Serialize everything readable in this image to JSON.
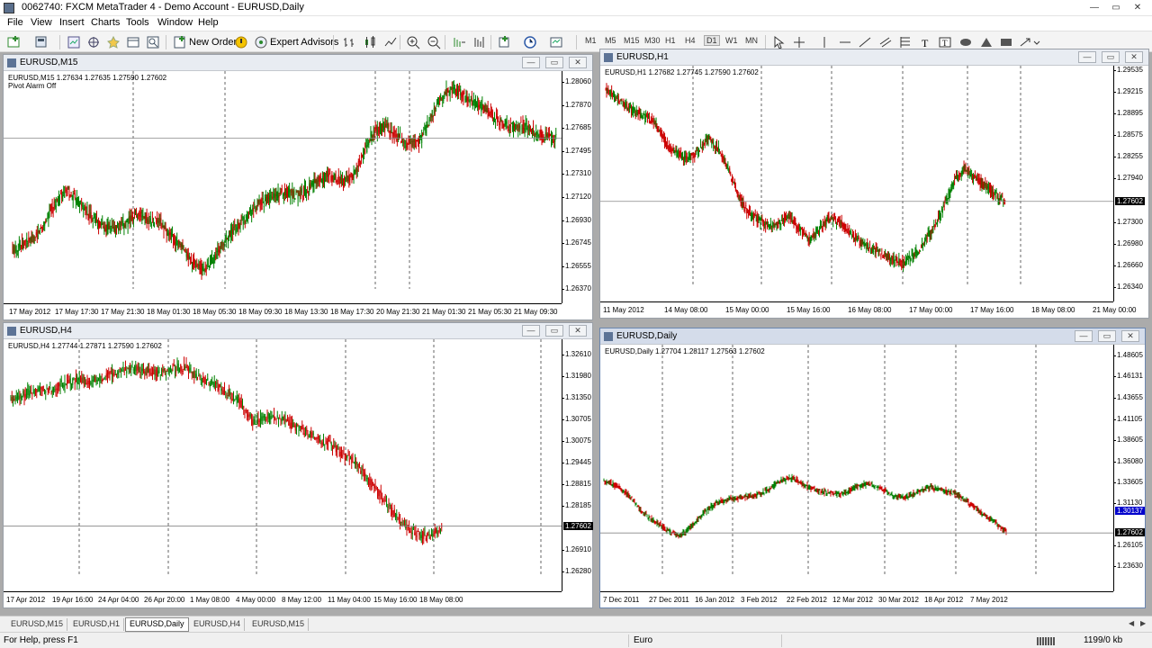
{
  "window": {
    "title": "0062740: FXCM MetaTrader 4 - Demo Account - EURUSD,Daily",
    "min": "—",
    "max": "▭",
    "close": "✕"
  },
  "menu": [
    "File",
    "View",
    "Insert",
    "Charts",
    "Tools",
    "Window",
    "Help"
  ],
  "toolbar": {
    "new_order": "New Order",
    "expert_advisors": "Expert Advisors",
    "timeframes": [
      "M1",
      "M5",
      "M15",
      "M30",
      "H1",
      "H4",
      "D1",
      "W1",
      "MN"
    ],
    "selected_timeframe": "D1"
  },
  "charts": [
    {
      "id": "m15",
      "title": "EURUSD,M15",
      "info": "EURUSD,M15  1.27634 1.27635 1.27590 1.27602",
      "info2": "Pivot Alarm Off",
      "prices": [
        "1.28060",
        "1.27870",
        "1.27685",
        "1.27495",
        "1.27310",
        "1.27120",
        "1.26930",
        "1.26745",
        "1.26555",
        "1.26370"
      ],
      "current_price": "1.27602",
      "times": [
        "17 May 2012",
        "17 May 17:30",
        "17 May 21:30",
        "18 May 01:30",
        "18 May 05:30",
        "18 May 09:30",
        "18 May 13:30",
        "18 May 17:30",
        "20 May 21:30",
        "21 May 01:30",
        "21 May 05:30",
        "21 May 09:30"
      ]
    },
    {
      "id": "h1",
      "title": "EURUSD,H1",
      "info": "EURUSD,H1  1.27682 1.27745 1.27590 1.27602",
      "prices": [
        "1.29535",
        "1.29215",
        "1.28895",
        "1.28575",
        "1.28255",
        "1.27940",
        "1.27602",
        "1.27300",
        "1.26980",
        "1.26660",
        "1.26340"
      ],
      "current_price": "1.27602",
      "times": [
        "11 May 2012",
        "14 May 08:00",
        "15 May 00:00",
        "15 May 16:00",
        "16 May 08:00",
        "17 May 00:00",
        "17 May 16:00",
        "18 May 08:00",
        "21 May 00:00"
      ]
    },
    {
      "id": "h4",
      "title": "EURUSD,H4",
      "info": "EURUSD,H4  1.27744 1.27871 1.27590 1.27602",
      "prices": [
        "1.32610",
        "1.31980",
        "1.31350",
        "1.30705",
        "1.30075",
        "1.29445",
        "1.28815",
        "1.28185",
        "1.27602",
        "1.26910",
        "1.26280"
      ],
      "current_price": "1.27602",
      "times": [
        "17 Apr 2012",
        "19 Apr 16:00",
        "24 Apr 04:00",
        "26 Apr 20:00",
        "1 May 08:00",
        "4 May 00:00",
        "8 May 12:00",
        "11 May 04:00",
        "15 May 16:00",
        "18 May 08:00"
      ]
    },
    {
      "id": "d1",
      "title": "EURUSD,Daily",
      "info": "EURUSD,Daily  1.27704 1.28117 1.27563 1.27602",
      "prices": [
        "1.48605",
        "1.46131",
        "1.43655",
        "1.41105",
        "1.38605",
        "1.36080",
        "1.33605",
        "1.31130",
        "1.30137",
        "1.27602",
        "1.26105",
        "1.23630"
      ],
      "current_price": "1.27602",
      "line_price": "1.30137",
      "times": [
        "7 Dec 2011",
        "27 Dec 2011",
        "16 Jan 2012",
        "3 Feb 2012",
        "22 Feb 2012",
        "12 Mar 2012",
        "30 Mar 2012",
        "18 Apr 2012",
        "7 May 2012"
      ]
    }
  ],
  "tabs": [
    "EURUSD,M15",
    "EURUSD,H1",
    "EURUSD,Daily",
    "EURUSD,H4",
    "EURUSD,M15"
  ],
  "selected_tab": "EURUSD,Daily",
  "status": {
    "help": "For Help, press F1",
    "profile": "Euro",
    "traffic": "1199/0 kb"
  },
  "colors": {
    "bull": "#008000",
    "bear": "#cc0000",
    "channel": "#000080",
    "level_line": "#0000cc",
    "zone": "#e8001c"
  },
  "chart_data": [
    {
      "type": "candlestick",
      "title": "EURUSD,M15",
      "ylim": [
        1.2637,
        1.2815
      ],
      "close_series": [
        1.2668,
        1.2674,
        1.2678,
        1.2693,
        1.271,
        1.2716,
        1.2706,
        1.2697,
        1.2688,
        1.2686,
        1.269,
        1.2699,
        1.2694,
        1.2692,
        1.268,
        1.267,
        1.2658,
        1.2652,
        1.2665,
        1.2679,
        1.269,
        1.27,
        1.2707,
        1.2712,
        1.2717,
        1.2714,
        1.2718,
        1.2726,
        1.273,
        1.2726,
        1.2728,
        1.2748,
        1.2766,
        1.277,
        1.2762,
        1.2754,
        1.2758,
        1.2778,
        1.2795,
        1.2801,
        1.2793,
        1.2788,
        1.2781,
        1.2774,
        1.2769,
        1.2771,
        1.2766,
        1.2762,
        1.276
      ]
    },
    {
      "type": "candlestick",
      "title": "EURUSD,H1",
      "ylim": [
        1.2634,
        1.296
      ],
      "close_series": [
        1.2926,
        1.2915,
        1.29,
        1.2892,
        1.2884,
        1.2872,
        1.2842,
        1.2831,
        1.2822,
        1.2833,
        1.2852,
        1.2839,
        1.2808,
        1.2768,
        1.2742,
        1.2733,
        1.2722,
        1.2728,
        1.2739,
        1.2717,
        1.2705,
        1.2722,
        1.2737,
        1.2728,
        1.2712,
        1.2698,
        1.2691,
        1.2683,
        1.2676,
        1.2669,
        1.2679,
        1.2697,
        1.2721,
        1.2752,
        1.2789,
        1.2809,
        1.2795,
        1.2782,
        1.2771,
        1.276
      ]
    },
    {
      "type": "candlestick",
      "title": "EURUSD,H4",
      "ylim": [
        1.2612,
        1.3305
      ],
      "close_series": [
        1.3131,
        1.3142,
        1.3161,
        1.3154,
        1.3176,
        1.3188,
        1.3181,
        1.3196,
        1.3211,
        1.3221,
        1.3214,
        1.3206,
        1.3219,
        1.3226,
        1.3193,
        1.3174,
        1.3153,
        1.3121,
        1.3066,
        1.3079,
        1.3074,
        1.3053,
        1.3034,
        1.3013,
        1.299,
        1.2963,
        1.2922,
        1.2871,
        1.2821,
        1.2774,
        1.2738,
        1.2728,
        1.276
      ]
    },
    {
      "type": "candlestick",
      "title": "EURUSD,Daily",
      "ylim": [
        1.224,
        1.499
      ],
      "close_series": [
        1.3381,
        1.3321,
        1.3214,
        1.3013,
        1.2905,
        1.2802,
        1.2721,
        1.2841,
        1.3001,
        1.3122,
        1.3162,
        1.3181,
        1.3202,
        1.3263,
        1.3373,
        1.3412,
        1.3322,
        1.3261,
        1.3231,
        1.3221,
        1.3301,
        1.3342,
        1.3283,
        1.3202,
        1.3181,
        1.3252,
        1.3301,
        1.3262,
        1.3221,
        1.3122,
        1.3001,
        1.2901,
        1.276
      ]
    }
  ]
}
